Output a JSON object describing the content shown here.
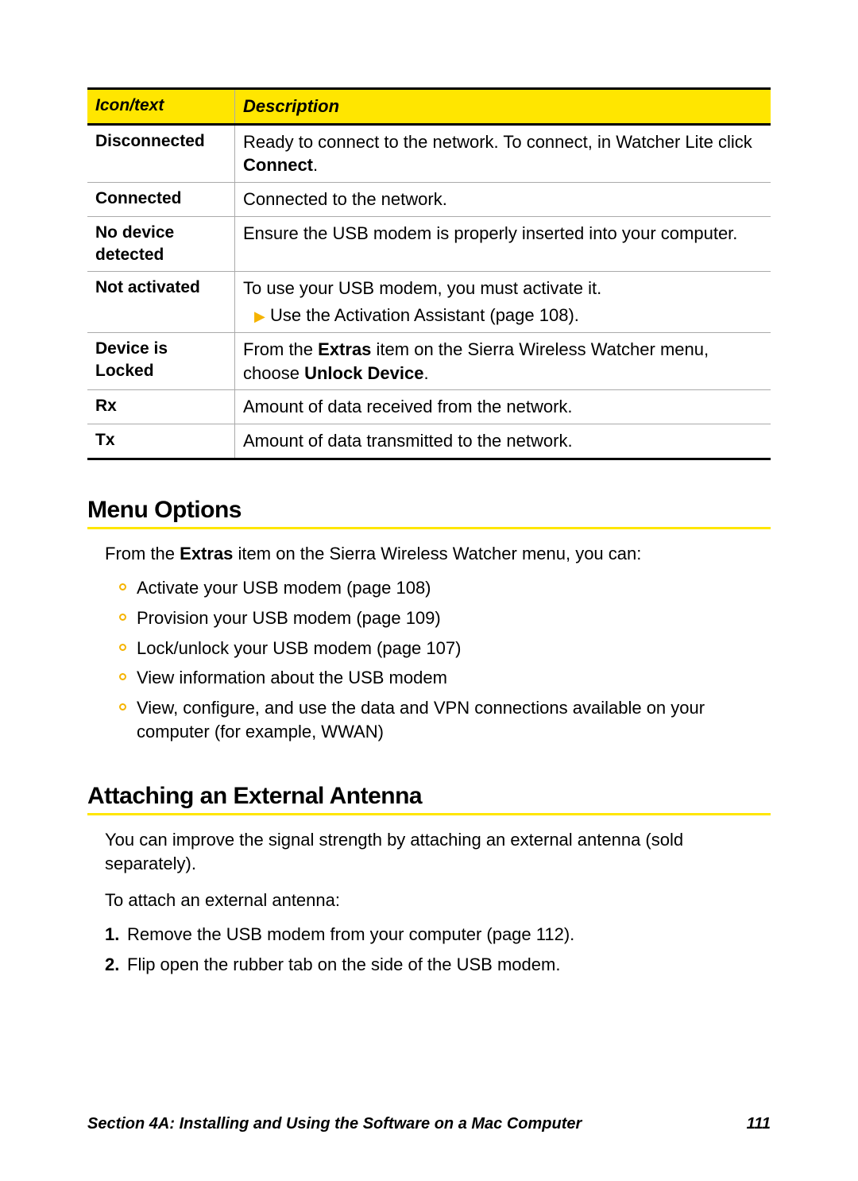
{
  "table": {
    "headers": [
      "Icon/text",
      "Description"
    ],
    "rows": [
      {
        "icon": "Disconnected",
        "desc_pre": "Ready to connect to the network. To connect, in Watcher Lite click ",
        "desc_bold": "Connect",
        "desc_post": "."
      },
      {
        "icon": "Connected",
        "desc": "Connected to the network."
      },
      {
        "icon": "No device detected",
        "desc": "Ensure the USB modem is properly inserted into your computer."
      },
      {
        "icon": "Not activated",
        "desc": "To use your USB modem, you must activate it.",
        "sub": "Use the Activation Assistant (page 108)."
      },
      {
        "icon": "Device is Locked",
        "desc_pre": "From the ",
        "desc_bold1": "Extras",
        "desc_mid": " item on the Sierra Wireless Watcher menu, choose ",
        "desc_bold2": "Unlock Device",
        "desc_post": "."
      },
      {
        "icon": "Rx",
        "desc": "Amount of data received from the network."
      },
      {
        "icon": "Tx",
        "desc": "Amount of data transmitted to the network."
      }
    ]
  },
  "menu_options": {
    "heading": "Menu Options",
    "intro_pre": "From the ",
    "intro_bold": "Extras",
    "intro_post": " item on the Sierra Wireless Watcher menu, you can:",
    "items": [
      "Activate your USB modem (page 108)",
      "Provision your USB modem (page 109)",
      "Lock/unlock your USB modem (page 107)",
      "View information about the USB modem",
      "View, configure, and use the data and VPN connections available on your computer (for example, WWAN)"
    ]
  },
  "antenna": {
    "heading": "Attaching an External Antenna",
    "para": "You can improve the signal strength by attaching an external antenna (sold separately).",
    "lead": "To attach an external antenna:",
    "steps": [
      "Remove the USB modem from your computer (page 112).",
      "Flip open the rubber tab on the side of the USB modem."
    ]
  },
  "footer": {
    "section": "Section 4A: Installing and Using the Software on a Mac Computer",
    "page": "111"
  }
}
